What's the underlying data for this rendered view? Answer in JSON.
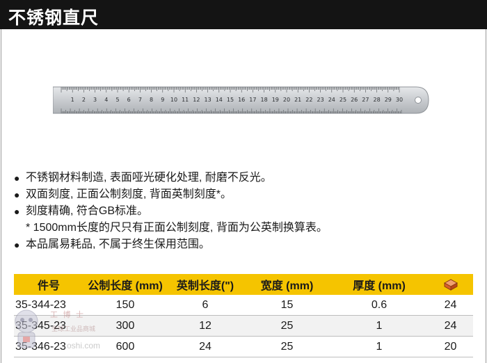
{
  "header": {
    "title": "不锈钢直尺"
  },
  "ruler": {
    "scale_labels": [
      "1",
      "2",
      "3",
      "4",
      "5",
      "6",
      "7",
      "8",
      "9",
      "10",
      "11",
      "12",
      "13",
      "14",
      "15",
      "16",
      "17",
      "18",
      "19",
      "20",
      "21",
      "22",
      "23",
      "24",
      "25",
      "26",
      "27",
      "28",
      "29",
      "30"
    ]
  },
  "features": [
    "不锈钢材料制造, 表面哑光硬化处理, 耐磨不反光。",
    "双面刻度, 正面公制刻度, 背面英制刻度*。",
    "刻度精确, 符合GB标准。"
  ],
  "note": "* 1500mm长度的尺只有正面公制刻度, 背面为公英制换算表。",
  "features_after": [
    "本品属易耗品, 不属于终生保用范围。"
  ],
  "table": {
    "headers": [
      "件号",
      "公制长度 (mm)",
      "英制长度(\")",
      "宽度 (mm)",
      "厚度 (mm)"
    ],
    "rows": [
      [
        "35-344-23",
        "150",
        "6",
        "15",
        "0.6",
        "24"
      ],
      [
        "35-345-23",
        "300",
        "12",
        "25",
        "1",
        "24"
      ],
      [
        "35-346-23",
        "600",
        "24",
        "25",
        "1",
        "20"
      ]
    ]
  },
  "watermark": {
    "text": "工 博 士",
    "sub": "全球工业品商城",
    "url": "…oshi.com"
  }
}
